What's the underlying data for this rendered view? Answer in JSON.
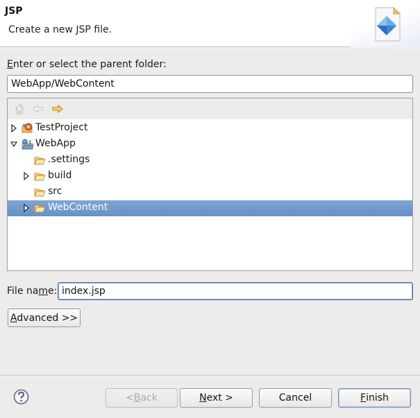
{
  "header": {
    "title": "JSP",
    "description": "Create a new JSP file.",
    "icon": "jsp-file-wizard-icon"
  },
  "parent_folder": {
    "label_mnemonic": "E",
    "label_rest": "nter or select the parent folder:",
    "value": "WebApp/WebContent"
  },
  "tree_toolbar": {
    "buttons": [
      {
        "icon": "home-icon",
        "enabled": false
      },
      {
        "icon": "back-arrow-icon",
        "enabled": false
      },
      {
        "icon": "forward-arrow-icon",
        "enabled": true
      }
    ]
  },
  "tree": {
    "items": [
      {
        "label": "TestProject",
        "level": 0,
        "expandable": true,
        "expanded": false,
        "icon": "project-icon",
        "selected": false
      },
      {
        "label": "WebApp",
        "level": 0,
        "expandable": true,
        "expanded": true,
        "icon": "web-project-icon",
        "selected": false
      },
      {
        "label": ".settings",
        "level": 1,
        "expandable": false,
        "expanded": false,
        "icon": "folder-icon",
        "selected": false
      },
      {
        "label": "build",
        "level": 1,
        "expandable": true,
        "expanded": false,
        "icon": "folder-icon",
        "selected": false
      },
      {
        "label": "src",
        "level": 1,
        "expandable": false,
        "expanded": false,
        "icon": "folder-icon",
        "selected": false
      },
      {
        "label": "WebContent",
        "level": 1,
        "expandable": true,
        "expanded": false,
        "icon": "folder-icon",
        "selected": true
      }
    ]
  },
  "file_name": {
    "label_pre": "File na",
    "label_mnemonic": "m",
    "label_post": "e:",
    "value": "index.jsp"
  },
  "advanced_button": {
    "mnemonic": "A",
    "rest": "dvanced >>"
  },
  "footer": {
    "help_icon": "help-icon",
    "back": {
      "pre": "< ",
      "mnemonic": "B",
      "rest": "ack",
      "enabled": false
    },
    "next": {
      "mnemonic": "N",
      "rest": "ext >",
      "enabled": true
    },
    "cancel": {
      "label": "Cancel",
      "enabled": true
    },
    "finish": {
      "mnemonic": "F",
      "rest": "inish",
      "enabled": true,
      "default": true
    }
  },
  "colors": {
    "selection": "#7199cc",
    "dialog_bg": "#edeceb",
    "focus_border": "#4a73a8"
  }
}
